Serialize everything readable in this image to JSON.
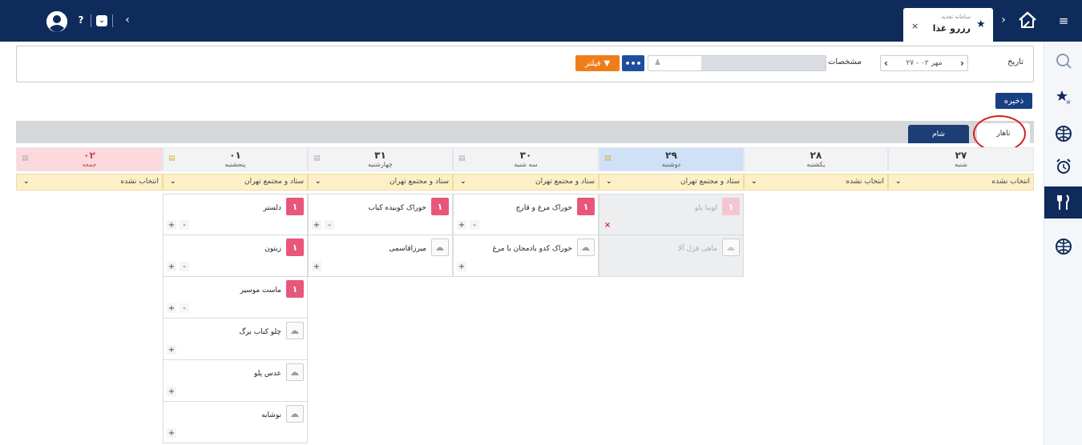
{
  "header": {
    "tab": {
      "subtitle": "سامانه تغذیه",
      "title": "رزرو غذا",
      "close": "×",
      "star": "★"
    },
    "help": "?",
    "expand": "⌄",
    "collapse": "‹",
    "next": "›",
    "menu": "≡"
  },
  "filter": {
    "date_label": "تاریخ",
    "date_value": "مهر ۰۲ - ۲۷",
    "date_prev": "‹",
    "date_next": "›",
    "spec_label": "مشخصات",
    "more_label": "•••",
    "filter_label": "فیلتر"
  },
  "save_label": "ذخیره",
  "meal_tabs": {
    "lunch": "ناهار",
    "dinner": "شام"
  },
  "days": [
    {
      "num": "۲۷",
      "name": "شنبه"
    },
    {
      "num": "۲۸",
      "name": "یکشنبه"
    },
    {
      "num": "۲۹",
      "name": "دوشنبه"
    },
    {
      "num": "۳۰",
      "name": "سه شنبه"
    },
    {
      "num": "۳۱",
      "name": "چهارشنبه"
    },
    {
      "num": "۰۱",
      "name": "پنجشنبه"
    },
    {
      "num": "۰۲",
      "name": "جمعه"
    }
  ],
  "locations": {
    "none": "انتخاب نشده",
    "tehran": "ستاد و مجتمع تهران"
  },
  "foods": {
    "mon_1": {
      "name": "لوبیا پلو",
      "count": "۱"
    },
    "mon_2": {
      "name": "ماهی قزل آلا"
    },
    "tue_1": {
      "name": "خوراک مرغ و قارچ",
      "count": "۱"
    },
    "tue_2": {
      "name": "خوراک کدو بادمجان با مرغ"
    },
    "wed_1": {
      "name": "خوراک کوبیده کباب",
      "count": "۱"
    },
    "wed_2": {
      "name": "میرزاقاسمی"
    },
    "thu_1": {
      "name": "دلستر",
      "count": "۱"
    },
    "thu_2": {
      "name": "زیتون",
      "count": "۱"
    },
    "thu_3": {
      "name": "ماست موسیر",
      "count": "۱"
    },
    "thu_4": {
      "name": "چلو کباب برگ"
    },
    "thu_5": {
      "name": "عدس پلو"
    },
    "thu_6": {
      "name": "نوشابه"
    }
  },
  "controls": {
    "plus": "+",
    "minus": "-",
    "cancel": "×"
  },
  "colors": {
    "navy": "#0f2b5b",
    "orange": "#ef7d1a",
    "pink": "#e8577a",
    "location_bg": "#fdf0c6",
    "highlight_day": "#cfe0f7",
    "friday": "#fbd9dd"
  },
  "icons": {
    "sidebar": [
      "search-icon",
      "favorites-icon",
      "globe-icon",
      "alarm-icon",
      "food-icon",
      "globe-icon"
    ]
  }
}
